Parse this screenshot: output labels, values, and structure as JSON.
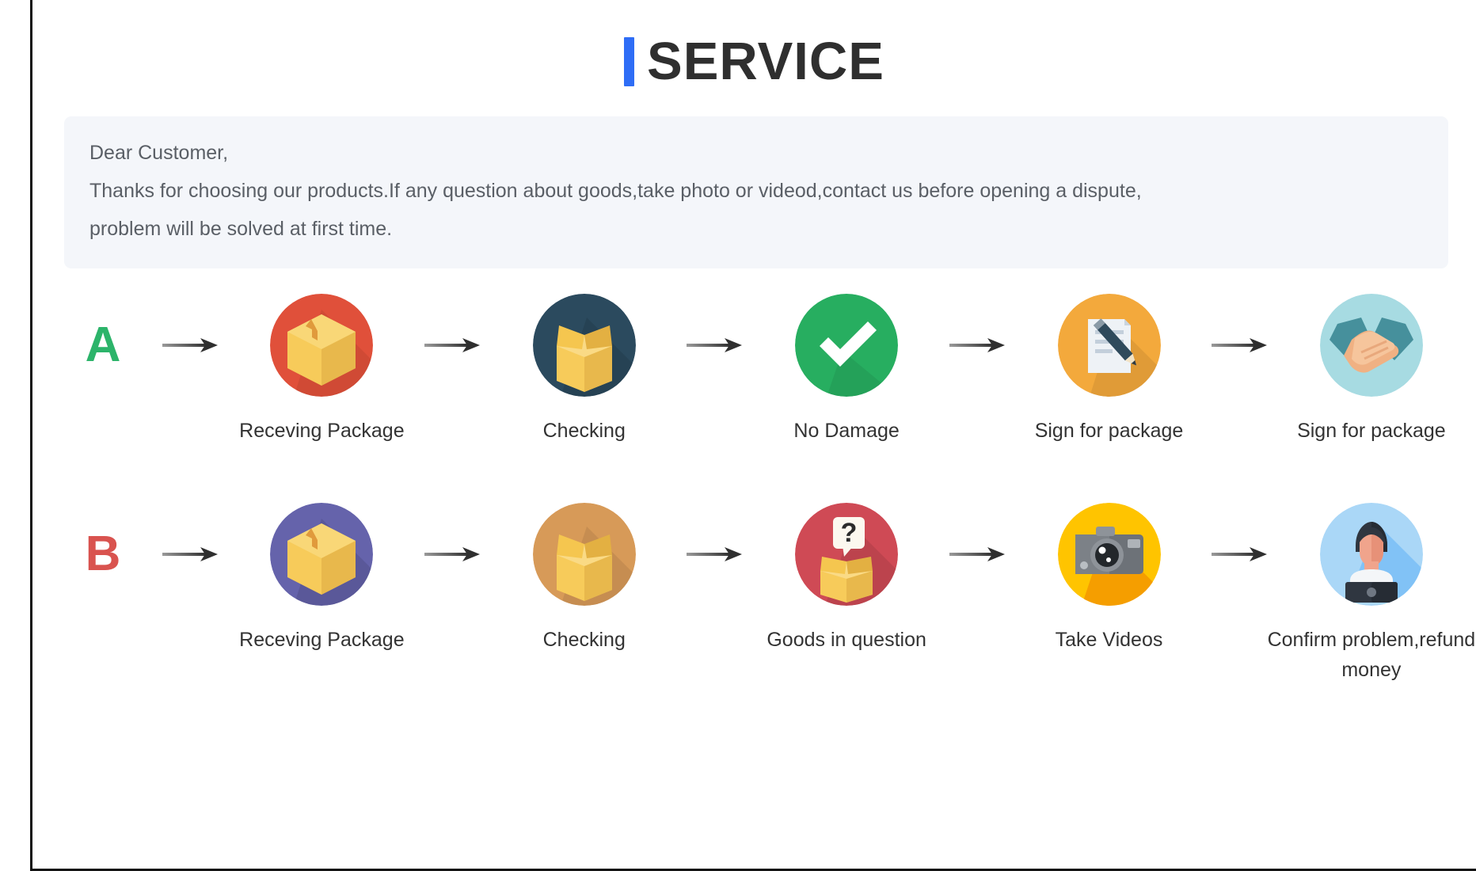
{
  "header": {
    "title": "SERVICE",
    "accent_color": "#2e6df6"
  },
  "notice": {
    "lines": [
      "Dear Customer,",
      "Thanks for choosing our products.If any question about goods,take photo or videod,contact us before opening a dispute,",
      "problem will be solved at first time."
    ],
    "background_color": "#f4f6fa"
  },
  "flows": [
    {
      "letter": "A",
      "letter_color": "#2cb46a",
      "steps": [
        {
          "label": "Receving Package",
          "icon": "closed-box-icon",
          "circle_color": "#e0503a"
        },
        {
          "label": "Checking",
          "icon": "open-box-icon",
          "circle_color": "#2b4a5e"
        },
        {
          "label": "No Damage",
          "icon": "check-mark-icon",
          "circle_color": "#27ae60"
        },
        {
          "label": "Sign for package",
          "icon": "document-pen-icon",
          "circle_color": "#f3a93c"
        },
        {
          "label": "Sign for package",
          "icon": "handshake-icon",
          "circle_color": "#a7dbe2"
        }
      ]
    },
    {
      "letter": "B",
      "letter_color": "#d9534f",
      "steps": [
        {
          "label": "Receving Package",
          "icon": "closed-box-icon",
          "circle_color": "#6563ab"
        },
        {
          "label": "Checking",
          "icon": "open-box-icon",
          "circle_color": "#d79a58"
        },
        {
          "label": "Goods in question",
          "icon": "question-box-icon",
          "circle_color": "#cf4a55"
        },
        {
          "label": "Take Videos",
          "icon": "camera-icon",
          "circle_color": "#ffc400"
        },
        {
          "label": "Confirm problem,refund money",
          "icon": "support-person-icon",
          "circle_color": "#aad7f7"
        }
      ]
    }
  ],
  "arrow": {
    "name": "right-arrow-icon",
    "color": "#3f3f3f"
  }
}
